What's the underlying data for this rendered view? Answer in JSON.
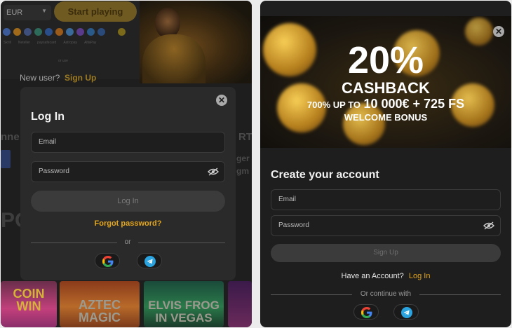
{
  "left": {
    "background": {
      "currency": "EUR",
      "start_button": "Start playing",
      "pay_labels": [
        "Skrill",
        "Neteller",
        "paysafecard",
        "Astropay",
        "AlfaPay"
      ],
      "or_small": "or use",
      "new_user": "New user?",
      "sign_up": "Sign Up",
      "side_left_1": "nne",
      "side_right_1": "RT",
      "side_right_2": "ger",
      "side_right_3": "gm",
      "side_left_big": "PO",
      "games": [
        {
          "line1": "COIN",
          "line2": "WIN"
        },
        {
          "line1": "AZTEC",
          "line2": "MAGIC"
        },
        {
          "line1": "ELVIS FROG",
          "line2": "IN VEGAS"
        }
      ]
    },
    "modal": {
      "title": "Log In",
      "email_placeholder": "Email",
      "password_placeholder": "Password",
      "login_button": "Log In",
      "forgot": "Forgot password?",
      "or": "or"
    }
  },
  "right": {
    "banner": {
      "percent": "20%",
      "cashback": "CASHBACK",
      "promo_prefix": "700% UP TO",
      "promo_amount": "10 000€ + 725 FS",
      "welcome": "WELCOME BONUS"
    },
    "form": {
      "title": "Create your account",
      "email_placeholder": "Email",
      "password_placeholder": "Password",
      "signup_button": "Sign Up",
      "have_account": "Have an Account?",
      "login_link": "Log In",
      "or_continue": "Or continue with"
    }
  },
  "icons": [
    "close-icon",
    "eye-off-icon",
    "google-icon",
    "telegram-icon"
  ],
  "colors": {
    "accent": "#e3a51c",
    "panel": "#2a2a2a",
    "background": "#1e1e1e",
    "telegram": "#2aa3df"
  }
}
